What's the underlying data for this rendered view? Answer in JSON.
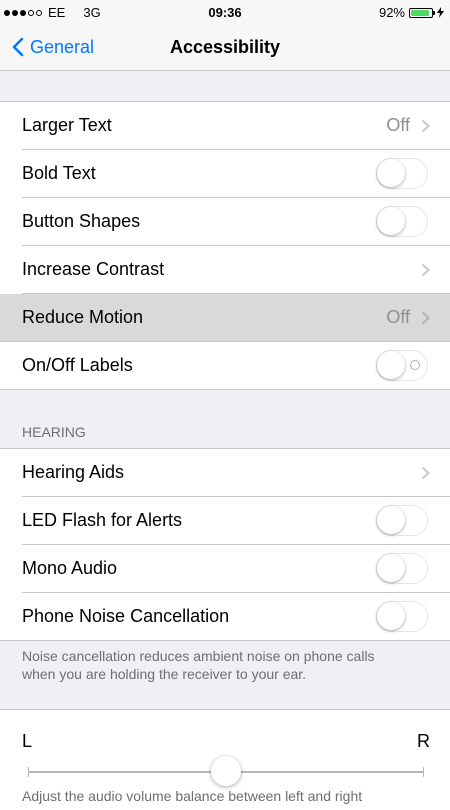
{
  "status_bar": {
    "carrier": "EE",
    "network": "3G",
    "time": "09:36",
    "battery_percent": "92%",
    "battery_level": 0.92,
    "signal_bars_filled": 3,
    "signal_bars_total": 5
  },
  "nav": {
    "back_label": "General",
    "title": "Accessibility"
  },
  "vision_rows": [
    {
      "label": "Larger Text",
      "value": "Off",
      "type": "disclosure"
    },
    {
      "label": "Bold Text",
      "type": "toggle",
      "on": false
    },
    {
      "label": "Button Shapes",
      "type": "toggle",
      "on": false
    },
    {
      "label": "Increase Contrast",
      "type": "disclosure"
    },
    {
      "label": "Reduce Motion",
      "value": "Off",
      "type": "disclosure",
      "highlighted": true
    },
    {
      "label": "On/Off Labels",
      "type": "toggle",
      "on": false,
      "labels": true
    }
  ],
  "hearing": {
    "header": "HEARING",
    "rows": [
      {
        "label": "Hearing Aids",
        "type": "disclosure"
      },
      {
        "label": "LED Flash for Alerts",
        "type": "toggle",
        "on": false
      },
      {
        "label": "Mono Audio",
        "type": "toggle",
        "on": false
      },
      {
        "label": "Phone Noise Cancellation",
        "type": "toggle",
        "on": false
      }
    ],
    "footer_line1": "Noise cancellation reduces ambient noise on phone calls",
    "footer_line2": "when you are holding the receiver to your ear."
  },
  "balance": {
    "left_label": "L",
    "right_label": "R",
    "position": 0.5,
    "bottom_text": "Adjust the audio volume balance between left and right"
  },
  "colors": {
    "accent": "#007aff",
    "battery_green": "#4cd964",
    "secondary_text": "#8e8e93",
    "background": "#efeff4"
  }
}
